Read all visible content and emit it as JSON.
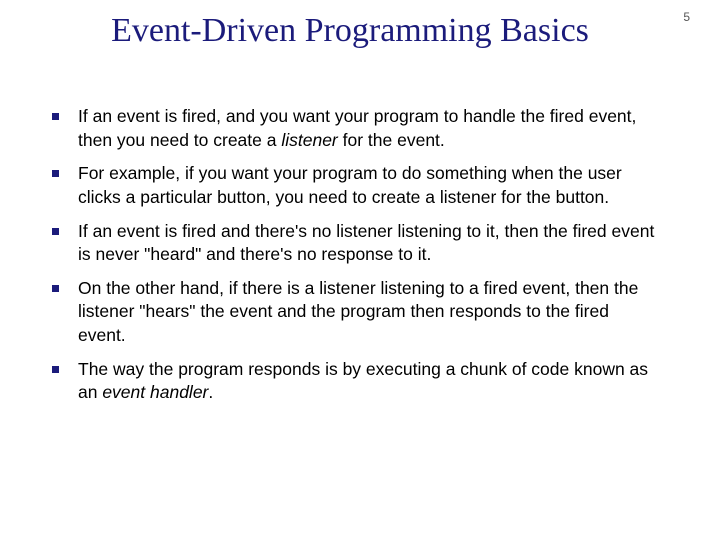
{
  "page_number": "5",
  "title": "Event-Driven Programming Basics",
  "bullets": [
    {
      "pre": "If an event is fired, and you want your program to handle the fired event, then you need to create a ",
      "em": "listener",
      "post": " for the event."
    },
    {
      "pre": "For example, if you want your program to do something when the user clicks a particular button, you need to create a listener for the button.",
      "em": "",
      "post": ""
    },
    {
      "pre": "If an event is fired and there's no listener listening to it, then the fired event is never \"heard\" and there's no response to it.",
      "em": "",
      "post": ""
    },
    {
      "pre": "On the other hand, if there is a listener listening to a fired event, then the listener \"hears\" the event and the program then responds to the fired event.",
      "em": "",
      "post": ""
    },
    {
      "pre": "The way the program responds is by executing a chunk of code known as an ",
      "em": "event handler",
      "post": "."
    }
  ]
}
